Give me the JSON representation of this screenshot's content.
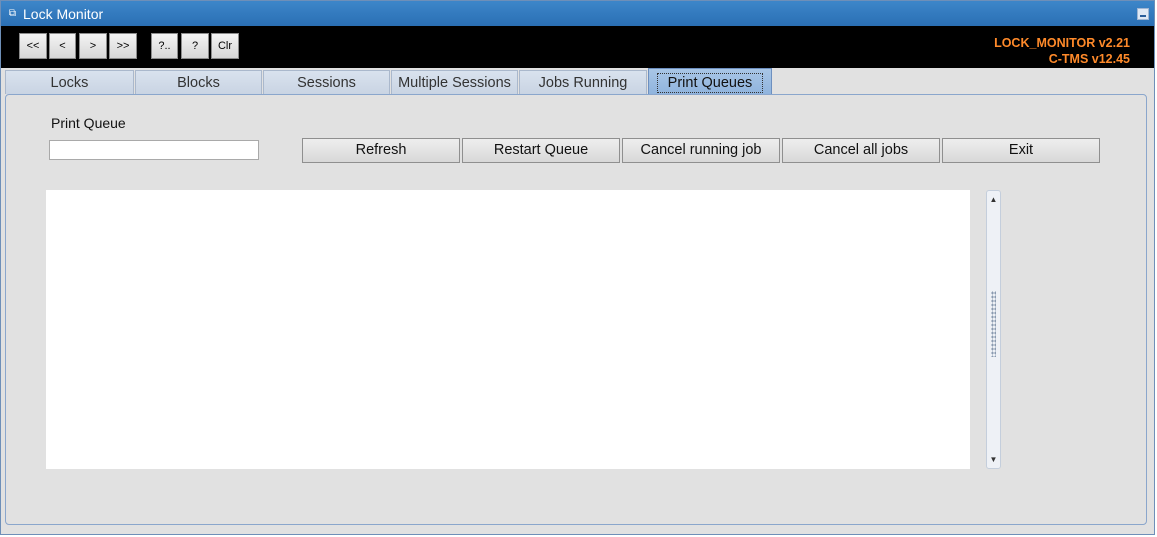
{
  "window": {
    "title": "Lock Monitor",
    "title_icon": "app-icon",
    "minimize_icon": "minimize-icon"
  },
  "toolbar": {
    "buttons": [
      {
        "label": "<<",
        "name": "first-record-button"
      },
      {
        "label": "<",
        "name": "previous-record-button"
      },
      {
        "label": ">",
        "name": "next-record-button"
      },
      {
        "label": ">>",
        "name": "last-record-button"
      },
      {
        "label": "?..",
        "name": "list-values-button"
      },
      {
        "label": "?",
        "name": "help-button"
      },
      {
        "label": "Clr",
        "name": "clear-button"
      }
    ],
    "version_line1": "LOCK_MONITOR v2.21",
    "version_line2": "C-TMS v12.45",
    "version_color": "#ff8a2a"
  },
  "tabs": [
    {
      "label": "Locks",
      "active": false
    },
    {
      "label": "Blocks",
      "active": false
    },
    {
      "label": "Sessions",
      "active": false
    },
    {
      "label": "Multiple Sessions",
      "active": false
    },
    {
      "label": "Jobs Running",
      "active": false
    },
    {
      "label": "Print Queues",
      "active": true
    }
  ],
  "print_queue": {
    "label": "Print Queue",
    "value": ""
  },
  "actions": {
    "refresh": "Refresh",
    "restart_queue": "Restart Queue",
    "cancel_running_job": "Cancel running job",
    "cancel_all_jobs": "Cancel all jobs",
    "exit": "Exit"
  },
  "scrollbar": {
    "up_icon": "scroll-up-icon",
    "down_icon": "scroll-down-icon"
  }
}
